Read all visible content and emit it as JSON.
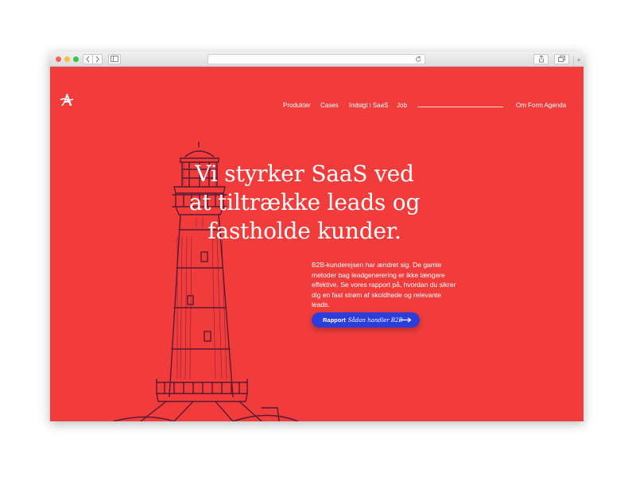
{
  "browser": {
    "icons": {
      "back": "chevron-left-icon",
      "forward": "chevron-right-icon",
      "sidebar": "sidebar-icon",
      "reload": "reload-icon",
      "share": "share-icon",
      "tabs": "tabs-icon",
      "new_tab": "plus-icon"
    },
    "new_tab_label": "+"
  },
  "header": {
    "logo_icon": "agenda-logo-icon",
    "nav": [
      {
        "label": "Produkter"
      },
      {
        "label": "Cases"
      },
      {
        "label": "Indsigt i SaaS"
      },
      {
        "label": "Job"
      }
    ],
    "about_label": "Om Form Agenda"
  },
  "hero": {
    "headline_lines": [
      "Vi styrker SaaS ved",
      "at tiltrække leads og",
      "fastholde kunder."
    ],
    "body": "B2B-kunderejsen har ændret sig. De gamle metoder bag leadgenerering er ikke længere effektive. Se vores rapport på, hvordan du sikrer dig en fast strøm af skoldhede og relevante leads.",
    "cta": {
      "label_bold": "Rapport",
      "label_italic": "Sådan handler B2B",
      "icon": "arrow-right-icon"
    },
    "illustration": "lighthouse-illustration"
  },
  "colors": {
    "background": "#f23c3c",
    "button": "#2c3ddd",
    "text": "#ffffff",
    "illustration_ink": "#5b1a33"
  }
}
